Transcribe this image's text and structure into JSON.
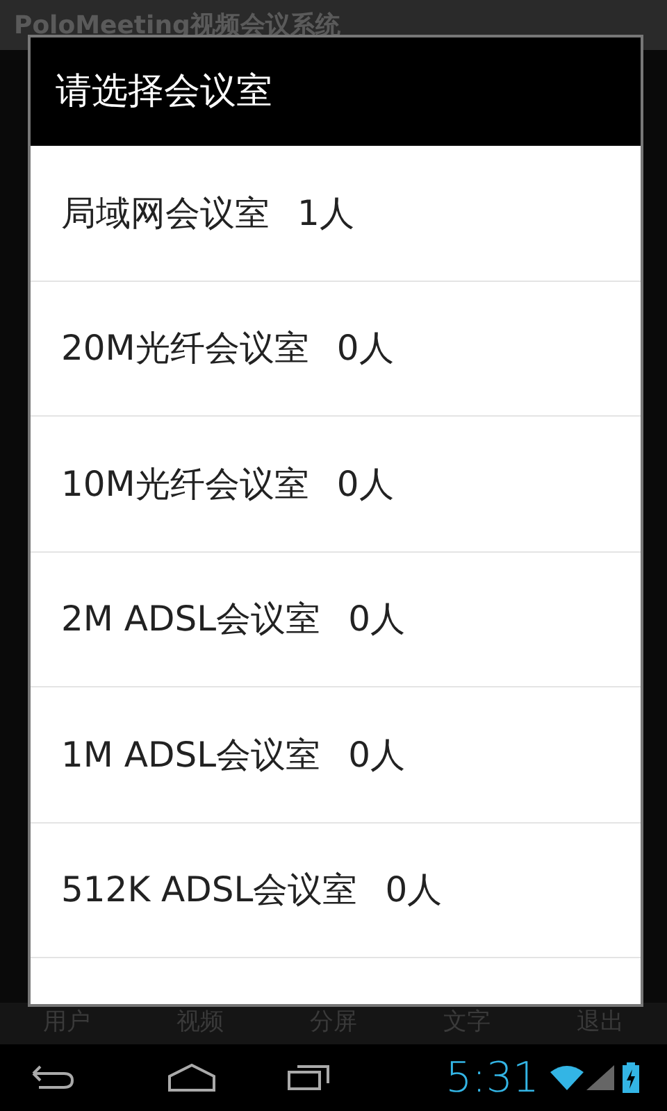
{
  "app_bar": {
    "title": "PoloMeeting视频会议系统"
  },
  "dialog": {
    "title": "请选择会议室",
    "rooms": [
      {
        "name": "局域网会议室",
        "count": "1人"
      },
      {
        "name": "20M光纤会议室",
        "count": "0人"
      },
      {
        "name": "10M光纤会议室",
        "count": "0人"
      },
      {
        "name": "2M ADSL会议室",
        "count": "0人"
      },
      {
        "name": "1M ADSL会议室",
        "count": "0人"
      },
      {
        "name": "512K ADSL会议室",
        "count": "0人"
      }
    ]
  },
  "bottom_tabs": [
    "用户",
    "视频",
    "分屏",
    "文字",
    "退出"
  ],
  "status_bar": {
    "time": "5:31"
  }
}
